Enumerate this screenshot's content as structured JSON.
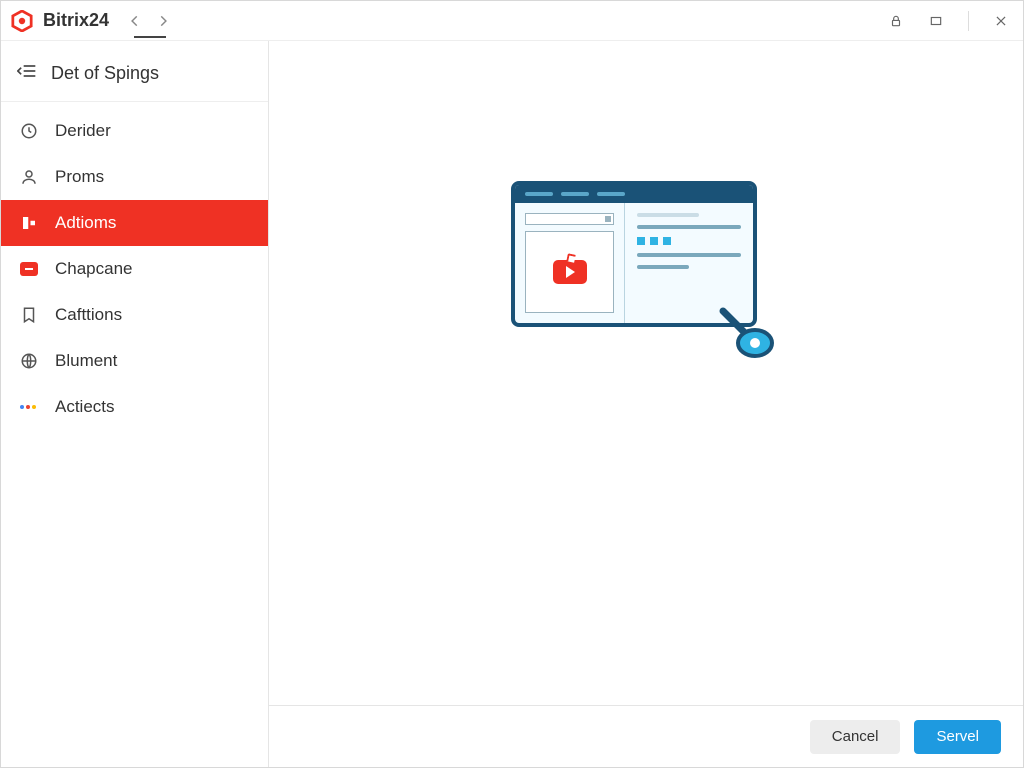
{
  "app": {
    "name": "Bitrix24"
  },
  "page": {
    "title": "Det of Spings"
  },
  "sidebar": {
    "items": [
      {
        "label": "Derider"
      },
      {
        "label": "Proms"
      },
      {
        "label": "Adtioms"
      },
      {
        "label": "Chapcane"
      },
      {
        "label": "Cafttions"
      },
      {
        "label": "Blument"
      },
      {
        "label": "Actiects"
      }
    ]
  },
  "footer": {
    "cancel": "Cancel",
    "submit": "Servel"
  },
  "colors": {
    "accent_red": "#ef3124",
    "primary_blue": "#1e9ae0",
    "illus_frame": "#1a5277"
  }
}
